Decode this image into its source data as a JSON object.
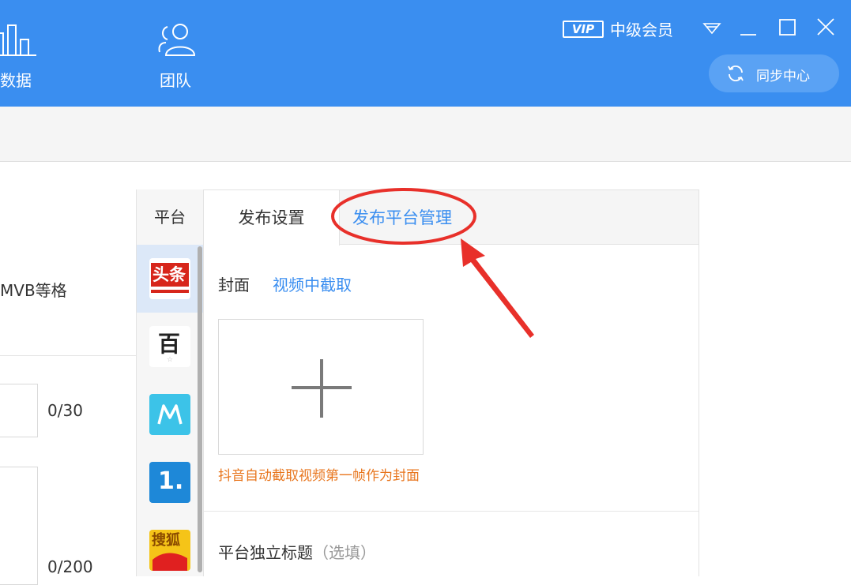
{
  "topbar": {
    "nav": [
      {
        "label": "数据",
        "icon": "bar-chart-icon"
      },
      {
        "label": "团队",
        "icon": "team-icon"
      }
    ],
    "vip_badge": "VIP",
    "vip_level": "中级会员",
    "sync_label": "同步中心",
    "colors": {
      "bar": "#3a8ef0"
    }
  },
  "left": {
    "format_text": "MVB等格",
    "title_count": "0/30",
    "desc_count": "0/200"
  },
  "platforms": {
    "header": "平台",
    "items": [
      {
        "name": "toutiao",
        "text": "头条",
        "selected": true
      },
      {
        "name": "baijiahao",
        "text": "百"
      },
      {
        "name": "m-platform",
        "text": "M"
      },
      {
        "name": "yidian",
        "text": "1."
      },
      {
        "name": "sohu",
        "text": "搜狐"
      }
    ]
  },
  "settings": {
    "tabs": [
      {
        "label": "发布设置",
        "active": true
      },
      {
        "label": "发布平台管理",
        "active": false
      }
    ],
    "cover_label": "封面",
    "cover_link": "视频中截取",
    "cover_note": "抖音自动截取视频第一帧作为封面",
    "indep_title": "平台独立标题",
    "indep_optional": "（选填）"
  }
}
